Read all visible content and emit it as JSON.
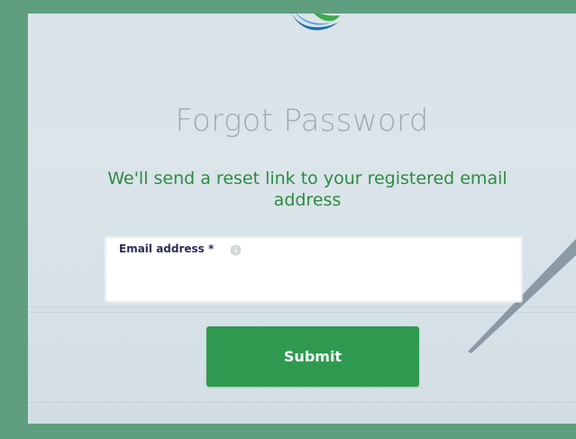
{
  "page": {
    "title": "Forgot Password",
    "subtitle": "We'll send a reset link to your registered email address"
  },
  "form": {
    "email_label": "Email address *",
    "email_value": ""
  },
  "actions": {
    "submit_label": "Submit"
  },
  "colors": {
    "outer_background": "#5f9f7f",
    "accent_green": "#2f8a44",
    "button_green": "#2f9a4f",
    "title_gray": "#a2a9ad"
  },
  "icons": {
    "logo": "brand-logo-icon",
    "info": "info-icon"
  }
}
